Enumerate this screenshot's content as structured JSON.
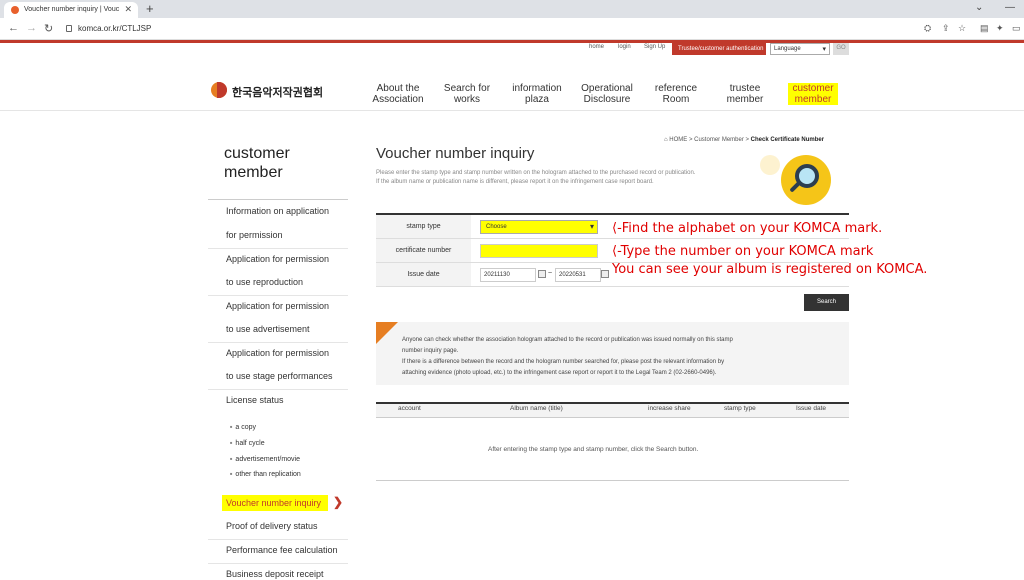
{
  "browser": {
    "tab_title": "Voucher number inquiry | Vouc",
    "url": "komca.or.kr/CTLJSP"
  },
  "util": {
    "home": "home",
    "login": "login",
    "signup": "Sign Up",
    "auth": "Trustee/customer authentication",
    "language": "Language",
    "go": "GO"
  },
  "header": {
    "logo_text": "한국음악저작권협회",
    "nav": [
      {
        "line1": "About the",
        "line2": "Association"
      },
      {
        "line1": "Search for",
        "line2": "works"
      },
      {
        "line1": "information",
        "line2": "plaza"
      },
      {
        "line1": "Operational",
        "line2": "Disclosure"
      },
      {
        "line1": "reference",
        "line2": "Room"
      },
      {
        "line1": "trustee",
        "line2": "member"
      },
      {
        "line1": "customer",
        "line2": "member"
      }
    ]
  },
  "sidebar": {
    "title_line1": "customer",
    "title_line2": "member",
    "items": [
      "Information on application",
      "for permission",
      "Application for permission",
      "to use reproduction",
      "Application for permission",
      "to use advertisement",
      "Application for permission",
      "to use stage performances",
      "License status"
    ],
    "sub_items": [
      "a copy",
      "half cycle",
      "advertisement/movie",
      "other than replication"
    ],
    "active": "Voucher number inquiry",
    "items_after": [
      "Proof of delivery status",
      "Performance fee calculation",
      "Business deposit receipt"
    ]
  },
  "main": {
    "breadcrumb_home": "HOME",
    "breadcrumb_mid": "Customer Member",
    "breadcrumb_current": "Check Certificate Number",
    "title": "Voucher number inquiry",
    "desc1": "Please enter the stamp type and stamp number written on the hologram attached to the purchased record or publication.",
    "desc2": "If the album name or publication name is different, please report it on the infringement case report board.",
    "form": {
      "stamp_type_label": "stamp type",
      "stamp_type_value": "Choose",
      "cert_label": "certificate number",
      "date_label": "Issue date",
      "date_from": "20211130",
      "date_to": "20220531"
    },
    "annotations": [
      "⟨-Find the alphabet on your KOMCA mark.",
      "⟨-Type the number on your KOMCA mark",
      "You can see your album is registered on KOMCA."
    ],
    "search_label": "Search",
    "notice": [
      "Anyone can check whether the association hologram attached to the record or publication was issued normally on this stamp",
      "number inquiry page.",
      "If there is a difference between the record and the hologram number searched for, please post the relevant information by",
      "attaching evidence (photo upload, etc.) to the infringement case report or report it to the Legal Team 2 (02-2660-0496)."
    ],
    "results": {
      "columns": [
        "account",
        "Album name (title)",
        "increase share",
        "stamp type",
        "Issue date"
      ],
      "empty": "After entering the stamp type and stamp number, click the Search button."
    }
  }
}
